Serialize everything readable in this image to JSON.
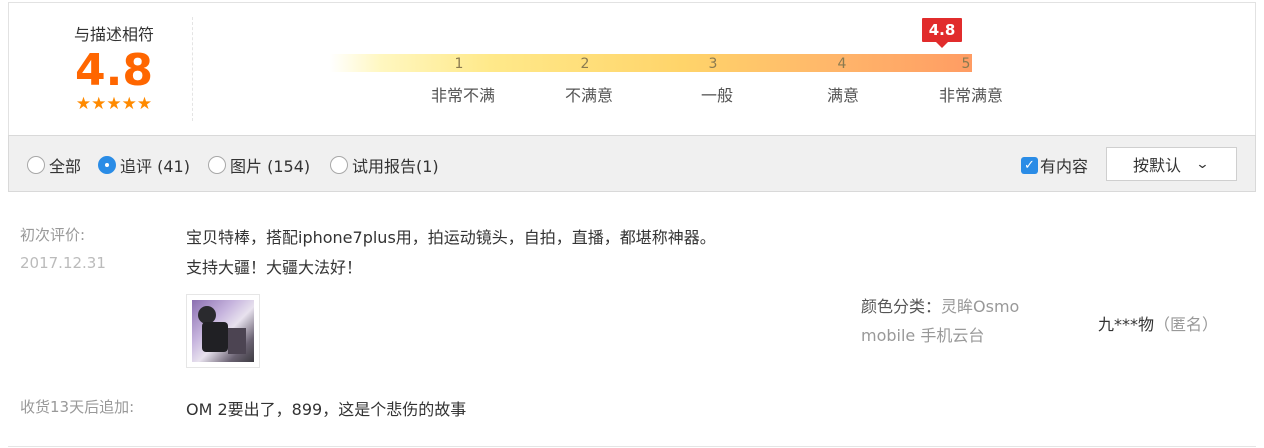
{
  "rating": {
    "title": "与描述相符",
    "score": "4.8",
    "stars": "★★★★★",
    "badge": "4.8",
    "scale_numbers": [
      "1",
      "2",
      "3",
      "4",
      "5"
    ],
    "scale_labels": [
      "非常不满",
      "不满意",
      "一般",
      "满意",
      "非常满意"
    ]
  },
  "filters": {
    "radios": [
      {
        "label": "全部",
        "checked": false
      },
      {
        "label": "追评 (41)",
        "checked": true
      },
      {
        "label": "图片 (154)",
        "checked": false
      },
      {
        "label": "试用报告(1)",
        "checked": false
      }
    ],
    "has_content_label": "有内容",
    "has_content_checked": true,
    "sort_label": "按默认"
  },
  "review": {
    "first_label": "初次评价:",
    "date": "2017.12.31",
    "text_line1": "宝贝特棒，搭配iphone7plus用，拍运动镜头，自拍，直播，都堪称神器。",
    "text_line2": "支持大疆！大疆大法好！",
    "sku_label": "颜色分类：",
    "sku_value_line1": "灵眸Osmo",
    "sku_value_line2": "mobile 手机云台",
    "user_name": "九***物",
    "user_anon": "（匿名）",
    "append_label": "收货13天后追加:",
    "append_text": "OM 2要出了，899，这是个悲伤的故事"
  }
}
